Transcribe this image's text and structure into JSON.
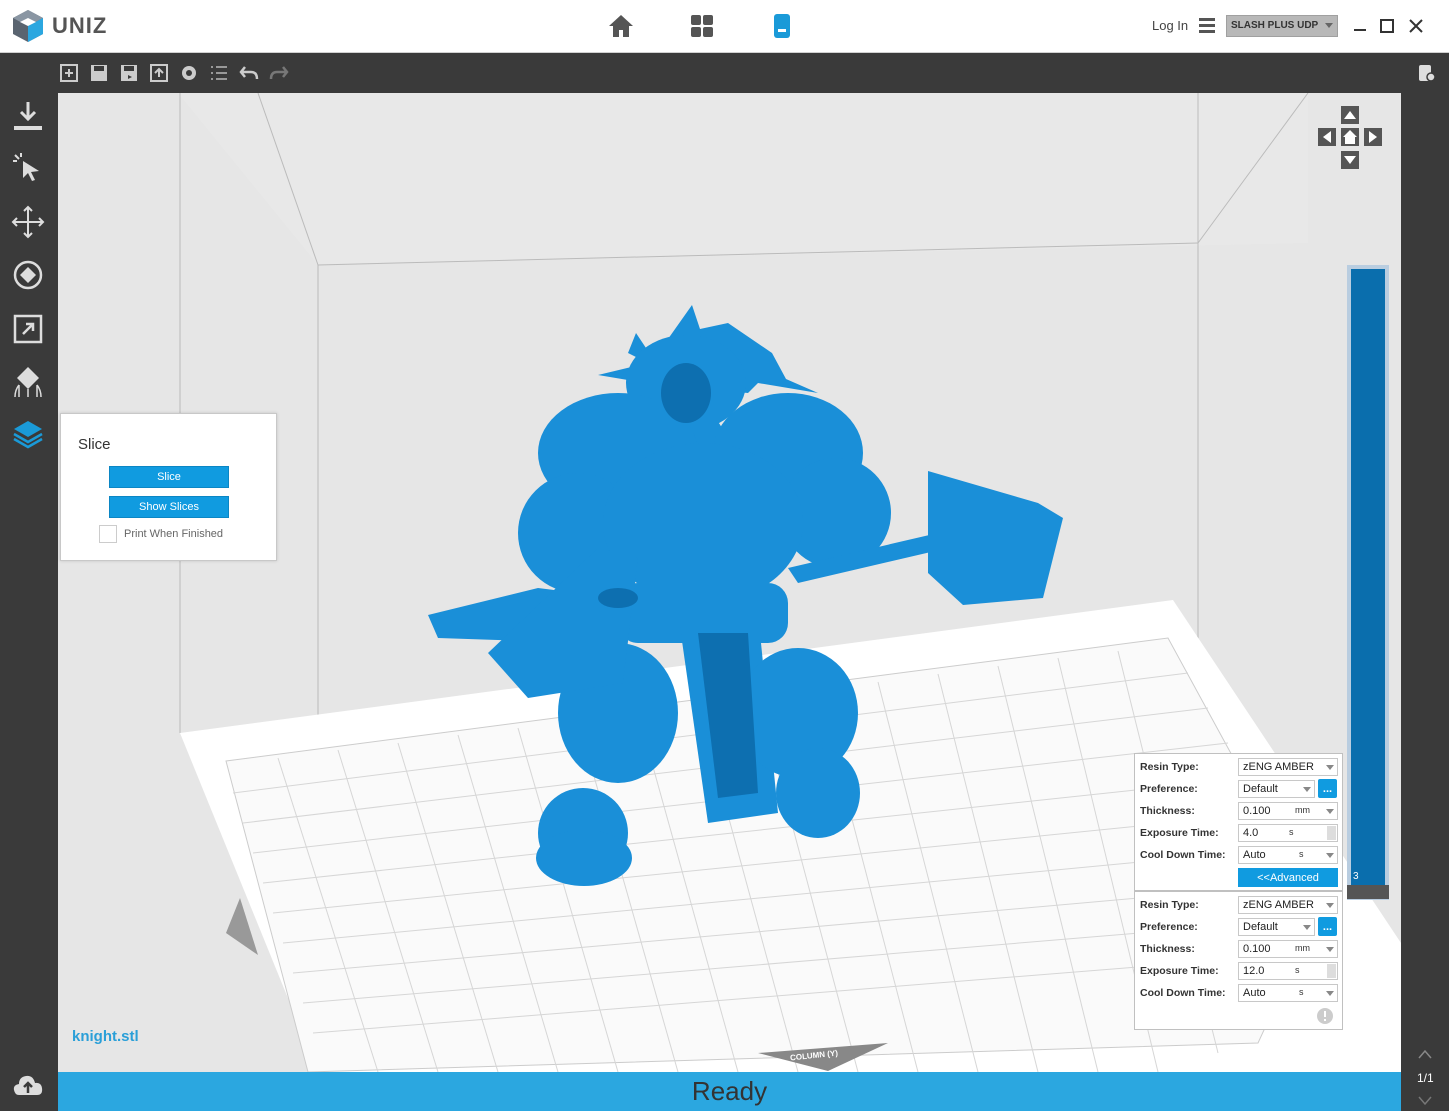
{
  "app": {
    "name": "UNIZ"
  },
  "header": {
    "login_label": "Log In",
    "printer": "SLASH PLUS UDP",
    "nav": [
      "home-icon",
      "apps-grid-icon",
      "printer-device-icon"
    ]
  },
  "toolbar": {
    "icons": [
      "add-model-icon",
      "save-icon",
      "save-as-icon",
      "export-icon",
      "settings-gear-icon",
      "list-icon",
      "undo-icon",
      "redo-icon"
    ]
  },
  "sidebar": {
    "tools": [
      "import-icon",
      "select-icon",
      "move-icon",
      "rotate-icon",
      "scale-icon",
      "support-icon",
      "slice-layers-icon"
    ]
  },
  "slice_panel": {
    "title": "Slice",
    "slice_button": "Slice",
    "show_slices_button": "Show Slices",
    "print_when_finished": "Print When Finished"
  },
  "settings_top": {
    "resin_type_label": "Resin Type:",
    "resin_type": "zENG AMBER",
    "preference_label": "Preference:",
    "preference": "Default",
    "more_button": "...",
    "thickness_label": "Thickness:",
    "thickness": "0.100",
    "thickness_unit": "mm",
    "exposure_label": "Exposure Time:",
    "exposure": "4.0",
    "exposure_unit": "s",
    "cooldown_label": "Cool Down Time:",
    "cooldown": "Auto",
    "cooldown_unit": "s",
    "advanced_button": "<<Advanced"
  },
  "settings_bottom": {
    "resin_type_label": "Resin Type:",
    "resin_type": "zENG AMBER",
    "preference_label": "Preference:",
    "preference": "Default",
    "more_button": "...",
    "thickness_label": "Thickness:",
    "thickness": "0.100",
    "thickness_unit": "mm",
    "exposure_label": "Exposure Time:",
    "exposure": "12.0",
    "exposure_unit": "s",
    "cooldown_label": "Cool Down Time:",
    "cooldown": "Auto",
    "cooldown_unit": "s"
  },
  "viewport": {
    "filename": "knight.stl",
    "platform_label": "COLUMN (Y)",
    "layer_value": "3"
  },
  "status": {
    "text": "Ready"
  },
  "pagination": {
    "page": "1/1"
  },
  "colors": {
    "accent": "#109be0",
    "model": "#1a8fd8",
    "status_bar": "#2ba7e0"
  }
}
